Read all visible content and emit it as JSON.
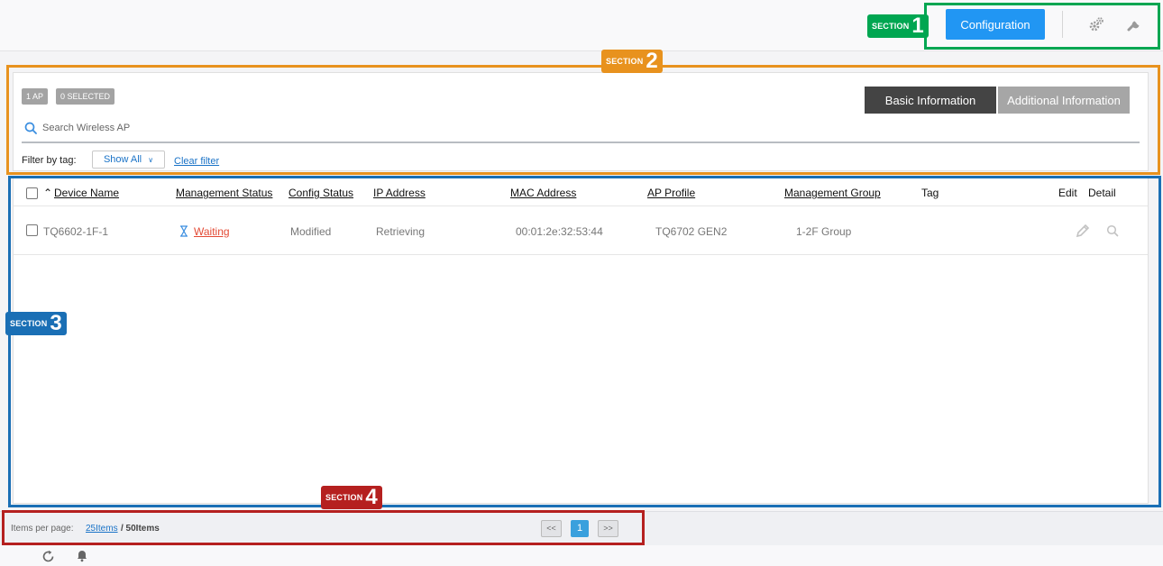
{
  "header": {
    "configuration_label": "Configuration",
    "icons": [
      "gears-icon",
      "wrench-icon"
    ]
  },
  "annotations": {
    "section_label": "SECTION",
    "s1": "1",
    "s2": "2",
    "s3": "3",
    "s4": "4",
    "colors": {
      "s1": "#00a651",
      "s2": "#e8921e",
      "s3": "#1a6fb5",
      "s4": "#b5201f"
    }
  },
  "toolbar": {
    "ap_count": "1 AP",
    "selected_count": "0 SELECTED",
    "tab_basic": "Basic Information",
    "tab_additional": "Additional Information",
    "search_placeholder": "Search Wireless AP",
    "filter_label": "Filter by tag:",
    "filter_value": "Show All",
    "clear_filter": "Clear filter"
  },
  "table": {
    "headers": {
      "device_name": "Device Name",
      "management_status": "Management Status",
      "config_status": "Config Status",
      "ip_address": "IP Address",
      "mac_address": "MAC Address",
      "ap_profile": "AP Profile",
      "management_group": "Management Group",
      "tag": "Tag",
      "edit": "Edit",
      "detail": "Detail"
    },
    "rows": [
      {
        "device_name": "TQ6602-1F-1",
        "management_status": "Waiting",
        "config_status": "Modified",
        "ip_address": "Retrieving",
        "mac_address": "00:01:2e:32:53:44",
        "ap_profile": "TQ6702 GEN2",
        "management_group": "1-2F Group",
        "tag": ""
      }
    ]
  },
  "pagination": {
    "items_per_page_label": "Items per page:",
    "per_page": "25Items",
    "total": "/ 50Items",
    "prev": "<<",
    "current_page": "1",
    "next": ">>"
  },
  "colors": {
    "primary": "#2196f3",
    "tab_active": "#444444",
    "tab_inactive": "#a6a6a6",
    "link": "#1a73c7",
    "waiting": "#e34a35"
  }
}
